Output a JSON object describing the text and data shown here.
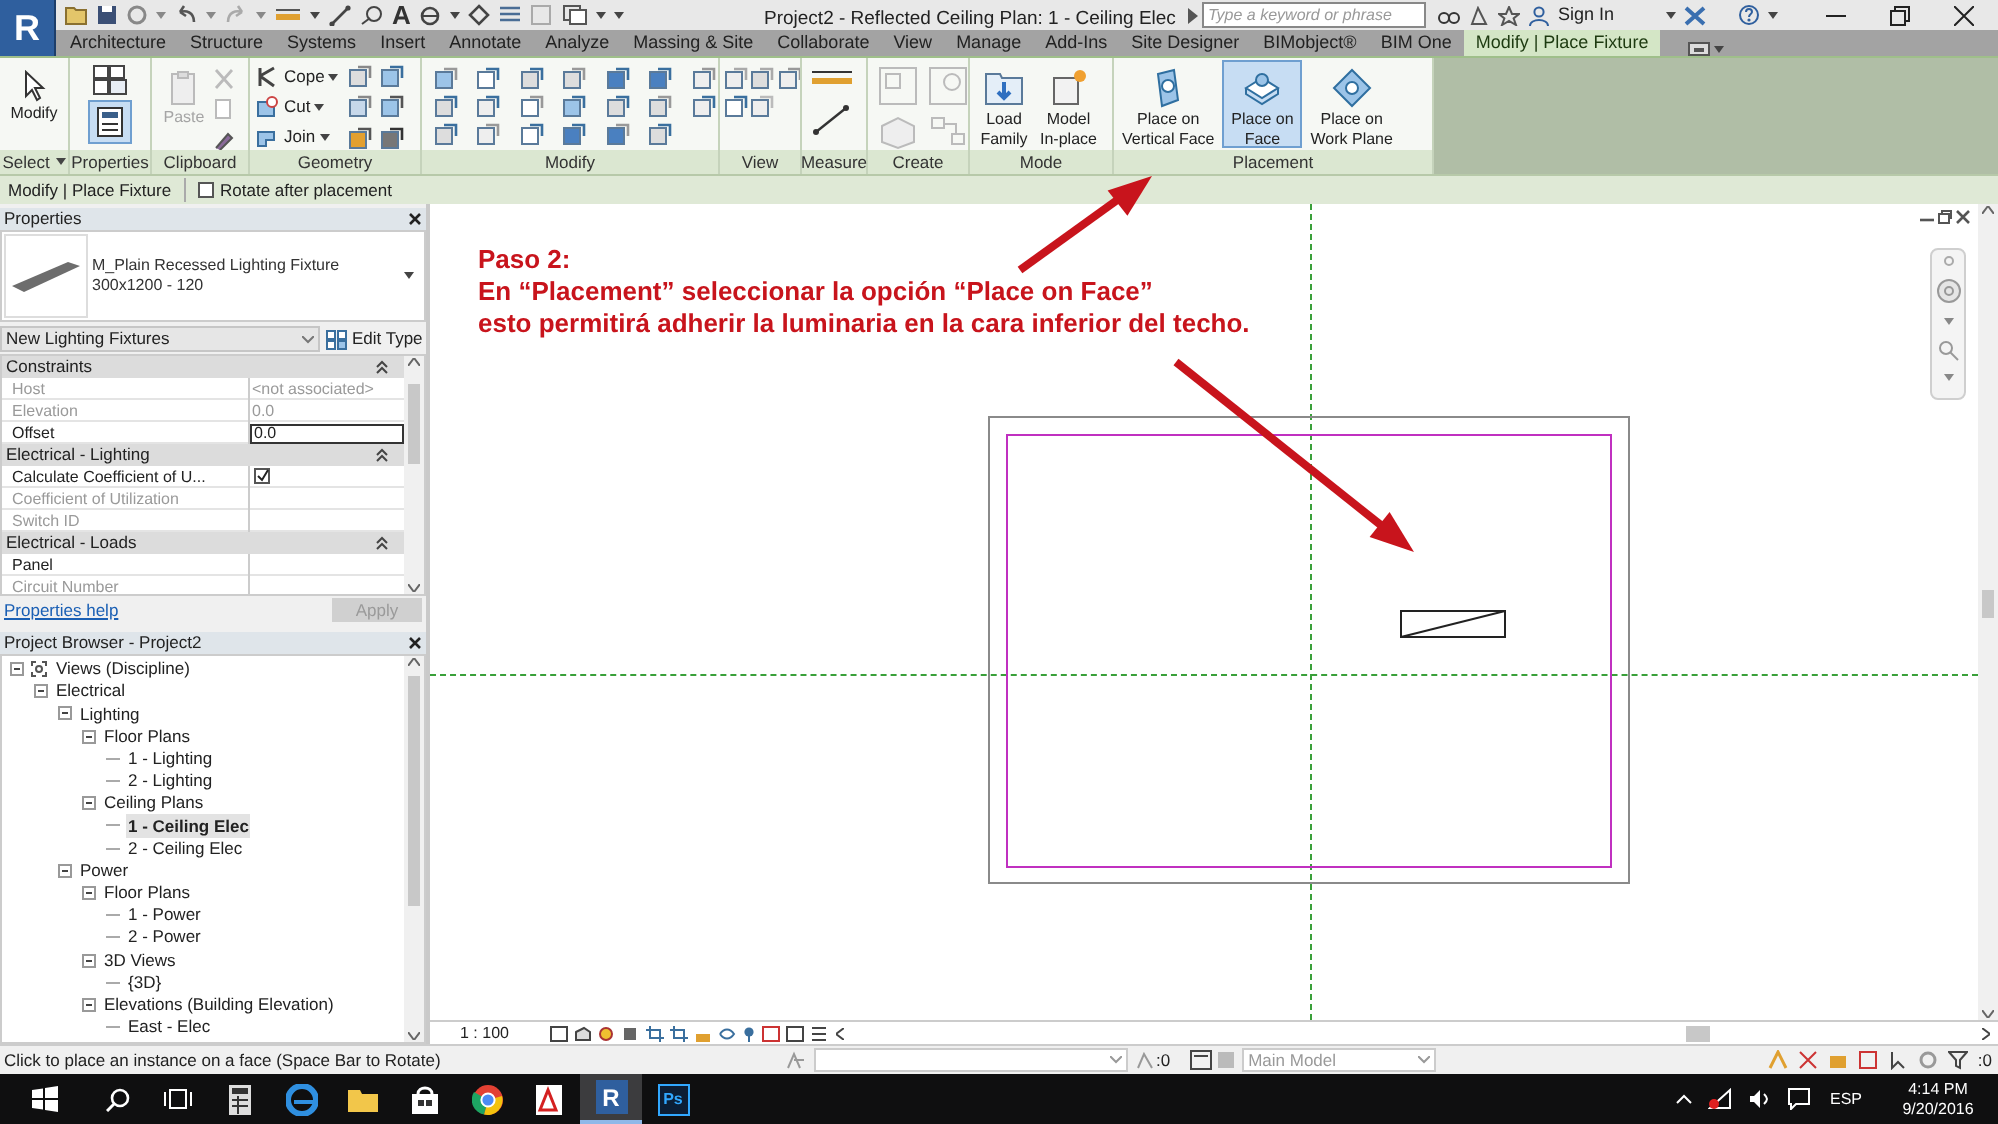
{
  "app_button": "R",
  "title_bar": {
    "text_tool": "A",
    "title": "Project2 - Reflected Ceiling Plan: 1 - Ceiling Elec",
    "search": {
      "placeholder": "Type a keyword or phrase"
    },
    "sign_in": "Sign In"
  },
  "ribbon_tabs": [
    {
      "label": "Architecture",
      "selected": false
    },
    {
      "label": "Structure",
      "selected": false
    },
    {
      "label": "Systems",
      "selected": false
    },
    {
      "label": "Insert",
      "selected": false
    },
    {
      "label": "Annotate",
      "selected": false
    },
    {
      "label": "Analyze",
      "selected": false
    },
    {
      "label": "Massing & Site",
      "selected": false
    },
    {
      "label": "Collaborate",
      "selected": false
    },
    {
      "label": "View",
      "selected": false
    },
    {
      "label": "Manage",
      "selected": false
    },
    {
      "label": "Add-Ins",
      "selected": false
    },
    {
      "label": "Site Designer",
      "selected": false
    },
    {
      "label": "BIMobject®",
      "selected": false
    },
    {
      "label": "BIM One",
      "selected": false
    },
    {
      "label": "Modify | Place Fixture",
      "selected": true
    }
  ],
  "ribbon_panels": [
    {
      "kind": "select",
      "label": "Select",
      "buttons": [
        {
          "label_lines": [
            "Modify"
          ],
          "selected": false,
          "disabled": false
        }
      ]
    },
    {
      "kind": "properties",
      "label": "Properties",
      "buttons": [
        {
          "selected": true
        }
      ]
    },
    {
      "kind": "clipboard",
      "label": "Clipboard",
      "buttons": [
        {
          "label_lines": [
            "Paste"
          ],
          "selected": false,
          "disabled": true
        }
      ]
    },
    {
      "kind": "geometry",
      "label": "Geometry",
      "buttons": [
        {
          "label_lines": [
            "Cope"
          ],
          "selected": false,
          "disabled": false
        },
        {
          "label_lines": [
            "Cut"
          ],
          "selected": false,
          "disabled": false
        },
        {
          "label_lines": [
            "Join"
          ],
          "selected": false,
          "disabled": false
        }
      ]
    },
    {
      "kind": "modify",
      "label": "Modify"
    },
    {
      "kind": "view",
      "label": "View"
    },
    {
      "kind": "measure",
      "label": "Measure"
    },
    {
      "kind": "create",
      "label": "Create"
    },
    {
      "kind": "mode",
      "label": "Mode",
      "buttons": [
        {
          "label_lines": [
            "Load",
            "Family"
          ],
          "selected": false,
          "disabled": false
        },
        {
          "label_lines": [
            "Model",
            "In-place"
          ],
          "selected": false,
          "disabled": false
        }
      ]
    },
    {
      "kind": "placement",
      "label": "Placement",
      "buttons": [
        {
          "label_lines": [
            "Place on",
            "Vertical Face"
          ],
          "selected": false,
          "disabled": false
        },
        {
          "label_lines": [
            "Place on",
            "Face"
          ],
          "selected": true,
          "disabled": false
        },
        {
          "label_lines": [
            "Place on",
            "Work Plane"
          ],
          "selected": false,
          "disabled": false
        }
      ]
    }
  ],
  "options_bar": {
    "context": "Modify | Place Fixture",
    "rotate_after_placement": {
      "label": "Rotate after placement",
      "checked": false
    }
  },
  "properties": {
    "title": "Properties",
    "type_name": "M_Plain Recessed Lighting Fixture",
    "type_size": "300x1200 - 120",
    "instance_filter": "New Lighting Fixtures",
    "edit_type": "Edit Type",
    "groups": [
      {
        "name": "Constraints",
        "params": [
          {
            "kind": "text",
            "label": "Host",
            "value": "<not associated>",
            "disabled": true
          },
          {
            "kind": "text",
            "label": "Elevation",
            "value": "0.0",
            "disabled": true
          },
          {
            "kind": "input",
            "label": "Offset",
            "value": "0.0",
            "disabled": false
          }
        ]
      },
      {
        "name": "Electrical - Lighting",
        "params": [
          {
            "kind": "checkbox",
            "label": "Calculate Coefficient of U...",
            "checked": true,
            "disabled": false
          },
          {
            "kind": "text",
            "label": "Coefficient of Utilization",
            "disabled": true
          },
          {
            "kind": "text",
            "label": "Switch ID",
            "disabled": true
          }
        ]
      },
      {
        "name": "Electrical - Loads",
        "params": [
          {
            "kind": "text",
            "label": "Panel",
            "disabled": false
          },
          {
            "kind": "text",
            "label": "Circuit Number",
            "disabled": true
          }
        ]
      }
    ],
    "help_link": "Properties help",
    "apply": {
      "label": "Apply",
      "disabled": true
    }
  },
  "project_browser": {
    "title": "Project Browser - Project2",
    "tree": [
      {
        "label": "Views (Discipline)",
        "expanded": true,
        "selected": false,
        "children": [
          {
            "label": "Electrical",
            "expanded": true,
            "selected": false,
            "children": [
              {
                "label": "Lighting",
                "expanded": true,
                "selected": false,
                "children": [
                  {
                    "label": "Floor Plans",
                    "expanded": true,
                    "selected": false,
                    "children": [
                      {
                        "label": "1 - Lighting",
                        "selected": false
                      },
                      {
                        "label": "2 - Lighting",
                        "selected": false
                      }
                    ]
                  },
                  {
                    "label": "Ceiling Plans",
                    "expanded": true,
                    "selected": false,
                    "children": [
                      {
                        "label": "1 - Ceiling Elec",
                        "selected": true
                      },
                      {
                        "label": "2 - Ceiling Elec",
                        "selected": false
                      }
                    ]
                  }
                ]
              },
              {
                "label": "Power",
                "expanded": true,
                "selected": false,
                "children": [
                  {
                    "label": "Floor Plans",
                    "expanded": true,
                    "selected": false,
                    "children": [
                      {
                        "label": "1 - Power",
                        "selected": false
                      },
                      {
                        "label": "2 - Power",
                        "selected": false
                      }
                    ]
                  },
                  {
                    "label": "3D Views",
                    "expanded": true,
                    "selected": false,
                    "children": [
                      {
                        "label": "{3D}",
                        "selected": false
                      }
                    ]
                  },
                  {
                    "label": "Elevations (Building Elevation)",
                    "expanded": true,
                    "selected": false,
                    "children": [
                      {
                        "label": "East - Elec",
                        "selected": false
                      }
                    ]
                  }
                ]
              }
            ]
          }
        ]
      }
    ]
  },
  "view": {
    "annotation": [
      "Paso 2:",
      "En “Placement” seleccionar la opción “Place on Face”",
      "esto permitirá adherir la luminaria en la cara inferior del techo."
    ],
    "scale": "1 : 100"
  },
  "status_bar": {
    "message": "Click to place an instance on a face (Space Bar to Rotate)",
    "editing_count": ":0",
    "design_option": "Main Model",
    "filter_count": ":0"
  },
  "taskbar": {
    "apps": [
      {
        "kind": "calculator",
        "active": false
      },
      {
        "kind": "edge",
        "active": false
      },
      {
        "kind": "explorer",
        "active": false
      },
      {
        "kind": "store",
        "active": false
      },
      {
        "kind": "chrome",
        "active": false
      },
      {
        "kind": "acrobat",
        "active": false
      },
      {
        "kind": "revit",
        "label": "R",
        "active": true
      },
      {
        "kind": "photoshop",
        "label": "Ps",
        "active": false
      }
    ],
    "language": "ESP",
    "time": "4:14 PM",
    "date": "9/20/2016"
  }
}
